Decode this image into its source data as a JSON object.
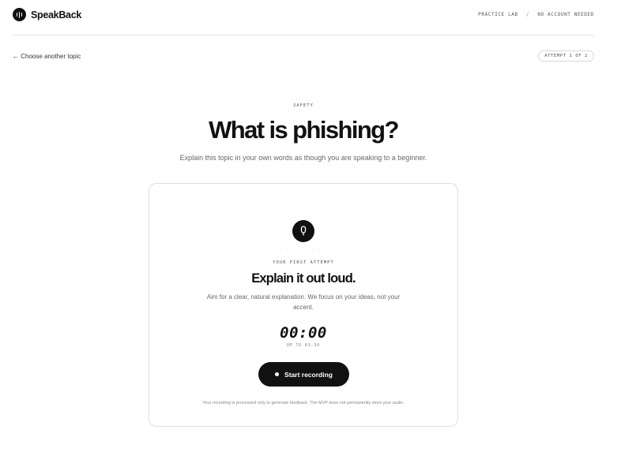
{
  "header": {
    "brand": "SpeakBack",
    "nav_left": "PRACTICE LAB",
    "nav_separator": "/",
    "nav_right": "NO ACCOUNT NEEDED"
  },
  "nav": {
    "back_label": "← Choose another topic",
    "attempt_label": "ATTEMPT 1 OF 2"
  },
  "topic": {
    "category": "SAFETY",
    "title": "What is phishing?",
    "instruction": "Explain this topic in your own words as though you are speaking to a beginner."
  },
  "recorder": {
    "progress_dots": "· · · · · · · · · ·",
    "attempt_label": "YOUR FIRST ATTEMPT",
    "heading": "Explain it out loud.",
    "description": "Aim for a clear, natural explanation. We focus on your ideas, not your accent.",
    "timer": "00:00",
    "limit": "UP TO 01:30",
    "record_label": "Start recording",
    "privacy_note": "Your recording is processed only to generate feedback. The MVP does not permanently store your audio."
  },
  "icons": {
    "logo": "waveform-icon",
    "mic": "microphone-icon",
    "record": "record-dot-icon"
  },
  "colors": {
    "text": "#111111",
    "muted": "#666666",
    "border": "#dedede",
    "button": "#111111"
  }
}
